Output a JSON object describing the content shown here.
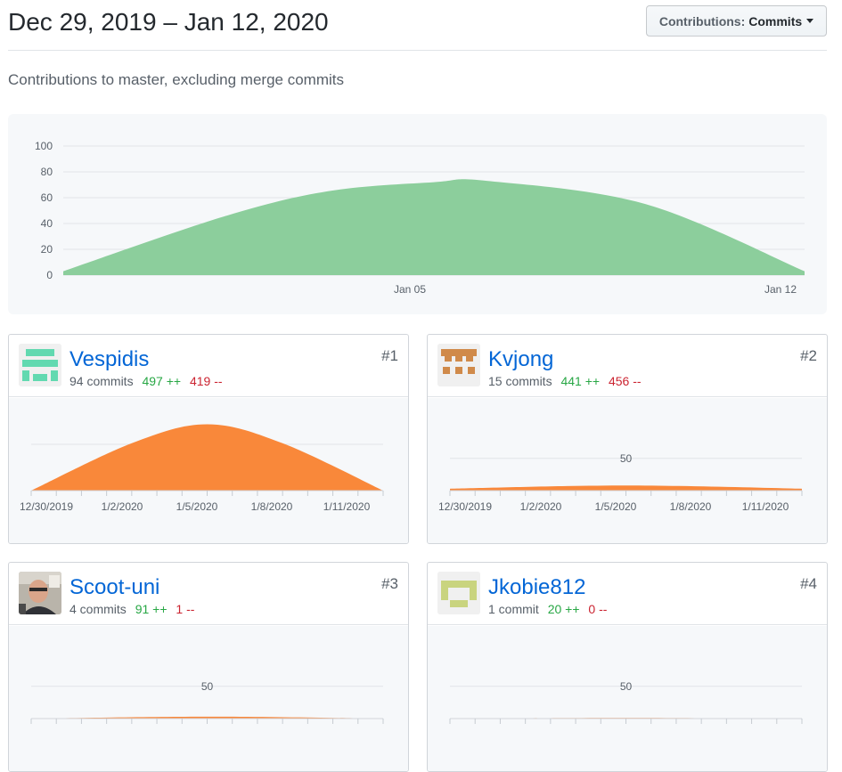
{
  "header": {
    "date_range": "Dec 29, 2019 – Jan 12, 2020",
    "type_select": {
      "label": "Contributions:",
      "value": "Commits"
    }
  },
  "subtitle": "Contributions to master, excluding merge commits",
  "colors": {
    "main_area": "#8cce9c",
    "contributor_area": "#f9883a",
    "link": "#0366d6",
    "additions": "#28a745",
    "deletions": "#cb2431"
  },
  "chart_data": [
    {
      "type": "area",
      "x_ticks": [
        "Jan 05",
        "Jan 12"
      ],
      "y_ticks": [
        "0",
        "20",
        "40",
        "60",
        "80",
        "100"
      ],
      "ylim": [
        0,
        100
      ],
      "x": [
        "2019-12-29",
        "2020-01-01",
        "2020-01-03",
        "2020-01-05",
        "2020-01-06",
        "2020-01-09",
        "2020-01-12"
      ],
      "values": [
        3,
        45,
        65,
        72,
        73,
        55,
        3
      ]
    },
    {
      "type": "area",
      "x_ticks": [
        "12/30/2019",
        "1/2/2020",
        "1/5/2020",
        "1/8/2020",
        "1/11/2020"
      ],
      "y_ticks": [],
      "ylim": [
        0,
        100
      ],
      "x": [
        "2019-12-29",
        "2020-01-02",
        "2020-01-05",
        "2020-01-08",
        "2020-01-12"
      ],
      "values": [
        0,
        70,
        98,
        70,
        0
      ]
    },
    {
      "type": "area",
      "x_ticks": [
        "12/30/2019",
        "1/2/2020",
        "1/5/2020",
        "1/8/2020",
        "1/11/2020"
      ],
      "y_ticks": [
        "50"
      ],
      "ylim": [
        0,
        105
      ],
      "x": [
        "2019-12-29",
        "2020-01-05",
        "2020-01-12"
      ],
      "values": [
        3,
        8,
        3
      ]
    },
    {
      "type": "area",
      "x_ticks": [],
      "y_ticks": [
        "50"
      ],
      "ylim": [
        0,
        105
      ],
      "x": [
        "2019-12-29",
        "2020-01-05",
        "2020-01-12"
      ],
      "values": [
        0,
        3,
        0
      ]
    },
    {
      "type": "area",
      "x_ticks": [],
      "y_ticks": [
        "50"
      ],
      "ylim": [
        0,
        105
      ],
      "x": [
        "2019-12-29",
        "2020-01-05",
        "2020-01-12"
      ],
      "values": [
        0,
        1,
        0
      ]
    }
  ],
  "contributors": [
    {
      "name": "Vespidis",
      "commits": "94 commits",
      "additions": "497 ++",
      "deletions": "419 --",
      "rank": "#1",
      "avatar_icon": "identicon-teal"
    },
    {
      "name": "Kvjong",
      "commits": "15 commits",
      "additions": "441 ++",
      "deletions": "456 --",
      "rank": "#2",
      "avatar_icon": "identicon-brown"
    },
    {
      "name": "Scoot-uni",
      "commits": "4 commits",
      "additions": "91 ++",
      "deletions": "1 --",
      "rank": "#3",
      "avatar_icon": "photo-avatar"
    },
    {
      "name": "Jkobie812",
      "commits": "1 commit",
      "additions": "20 ++",
      "deletions": "0 --",
      "rank": "#4",
      "avatar_icon": "identicon-olive"
    }
  ]
}
